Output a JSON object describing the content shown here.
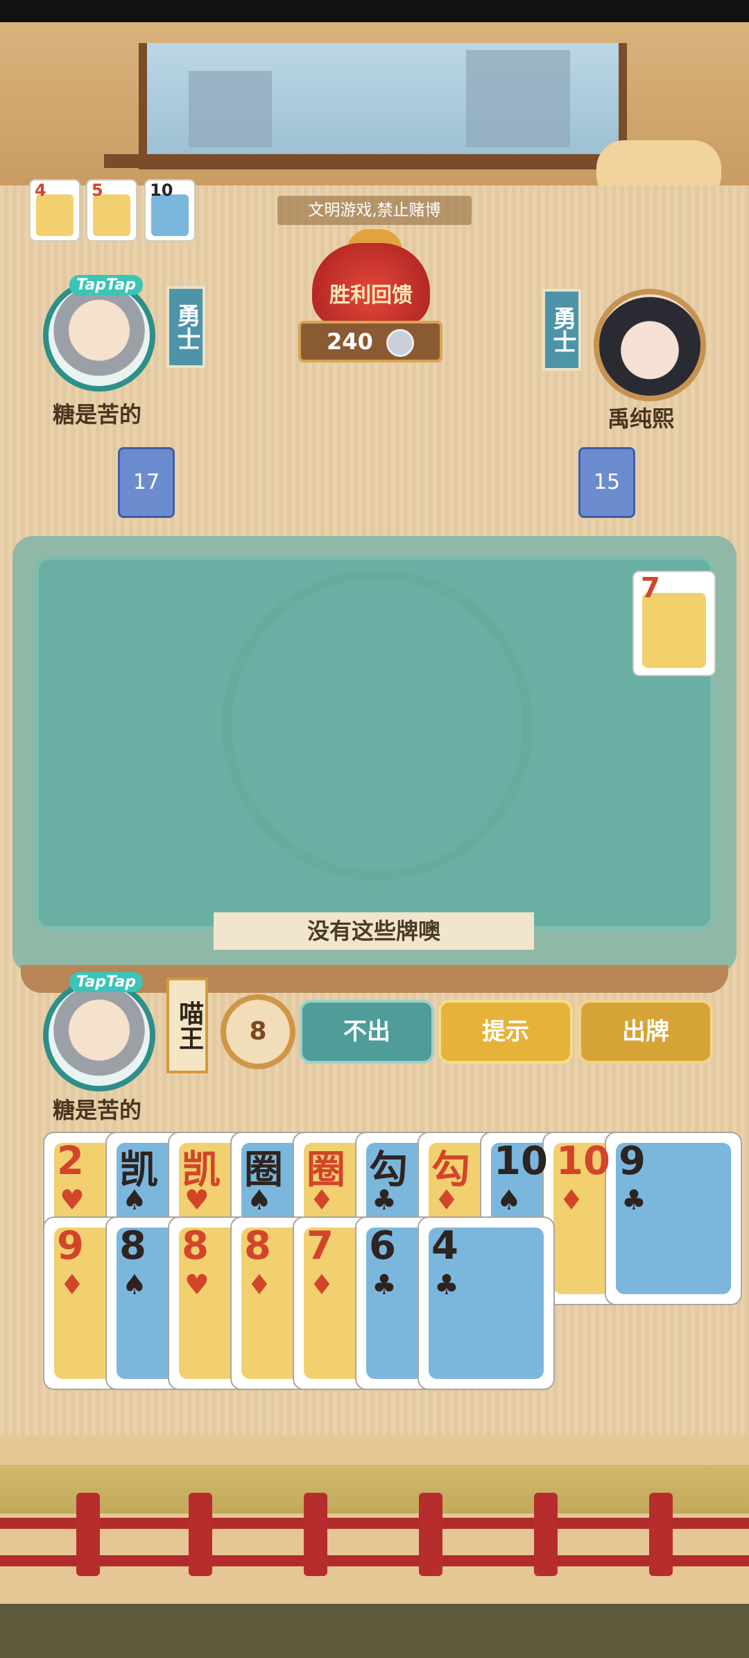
{
  "banner": {
    "notice": "文明游戏,禁止赌博"
  },
  "recent_cards": [
    {
      "rank": "4",
      "suit": "♥",
      "color": "red"
    },
    {
      "rank": "5",
      "suit": "♦",
      "color": "red"
    },
    {
      "rank": "10",
      "suit": "♣",
      "color": "black"
    }
  ],
  "reward": {
    "label": "胜利回馈",
    "coins": "240"
  },
  "players": {
    "left": {
      "brand": "TapTap",
      "name": "糖是苦的",
      "title": "勇士",
      "cards_left": "17"
    },
    "right": {
      "name": "禹纯熙",
      "title": "勇士",
      "cards_left": "15"
    },
    "me": {
      "brand": "TapTap",
      "name": "糖是苦的",
      "title": "喵王"
    }
  },
  "table": {
    "played_card": {
      "rank": "7",
      "suit": "♥",
      "color": "red"
    },
    "message": "没有这些牌噢"
  },
  "actions": {
    "timer": "8",
    "pass": "不出",
    "hint": "提示",
    "play": "出牌"
  },
  "hand": {
    "row1": [
      {
        "rank": "2",
        "suit": "♥",
        "color": "red"
      },
      {
        "rank": "凯",
        "suit": "♠",
        "color": "black"
      },
      {
        "rank": "凯",
        "suit": "♥",
        "color": "red"
      },
      {
        "rank": "圈",
        "suit": "♠",
        "color": "black"
      },
      {
        "rank": "圈",
        "suit": "♦",
        "color": "red"
      },
      {
        "rank": "勾",
        "suit": "♣",
        "color": "black"
      },
      {
        "rank": "勾",
        "suit": "♦",
        "color": "red"
      },
      {
        "rank": "10",
        "suit": "♠",
        "color": "black"
      },
      {
        "rank": "10",
        "suit": "♦",
        "color": "red"
      },
      {
        "rank": "9",
        "suit": "♣",
        "color": "black"
      }
    ],
    "row2": [
      {
        "rank": "9",
        "suit": "♦",
        "color": "red"
      },
      {
        "rank": "8",
        "suit": "♠",
        "color": "black"
      },
      {
        "rank": "8",
        "suit": "♥",
        "color": "red"
      },
      {
        "rank": "8",
        "suit": "♦",
        "color": "red"
      },
      {
        "rank": "7",
        "suit": "♦",
        "color": "red"
      },
      {
        "rank": "6",
        "suit": "♣",
        "color": "black"
      },
      {
        "rank": "4",
        "suit": "♣",
        "color": "black"
      }
    ]
  },
  "colors": {
    "felt": "#6aafa3",
    "accent_teal": "#4f9c99",
    "accent_gold": "#e6b33a",
    "red_suit": "#d2452b"
  }
}
